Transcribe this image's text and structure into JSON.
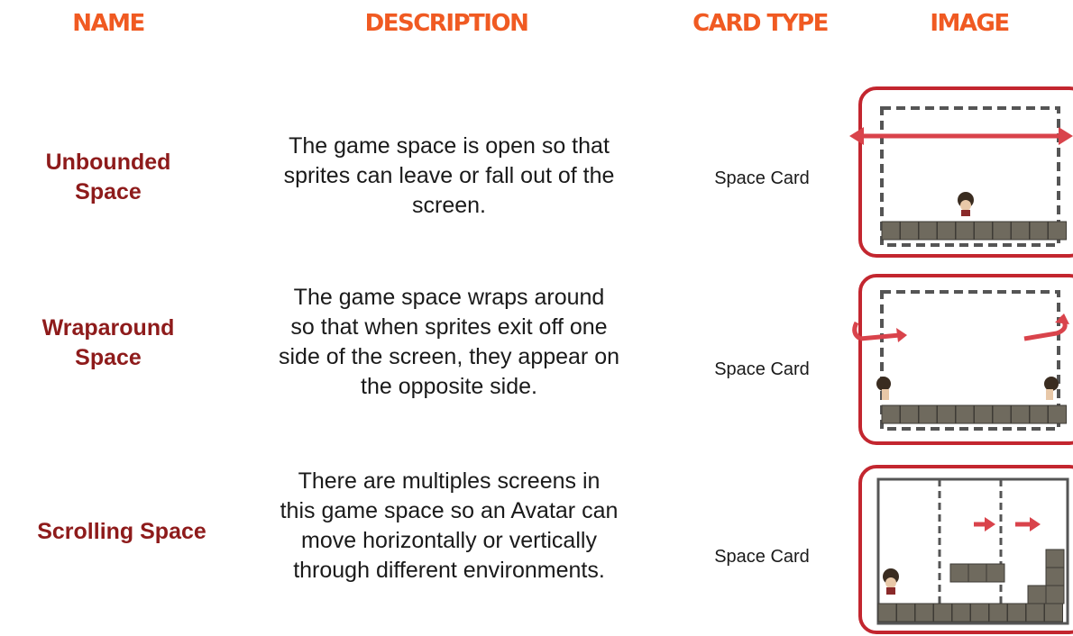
{
  "headers": {
    "name": "NAME",
    "description": "DESCRIPTION",
    "card_type": "CARD TYPE",
    "image": "IMAGE"
  },
  "rows": [
    {
      "name_lines": [
        "Unbounded",
        "Space"
      ],
      "description_lines": [
        "The game space is open so that",
        "sprites can leave or fall out of the",
        "screen."
      ],
      "card_type": "Space Card",
      "image_icon": "unbounded-space-diagram"
    },
    {
      "name_lines": [
        "Wraparound",
        "Space"
      ],
      "description_lines": [
        "The game space wraps around",
        "so that when sprites exit off one",
        "side of the screen, they appear on",
        "the opposite side."
      ],
      "card_type": "Space Card",
      "image_icon": "wraparound-space-diagram"
    },
    {
      "name_lines": [
        "Scrolling Space"
      ],
      "description_lines": [
        "There are multiples screens in",
        "this game space so an Avatar can",
        "move horizontally or vertically",
        "through different environments."
      ],
      "card_type": "Space Card",
      "image_icon": "scrolling-space-diagram"
    }
  ],
  "colors": {
    "header": "#f05a22",
    "name": "#8e1b1b",
    "card_border": "#c3262f",
    "arrow": "#d9434b",
    "block": "#6f6a5e"
  }
}
